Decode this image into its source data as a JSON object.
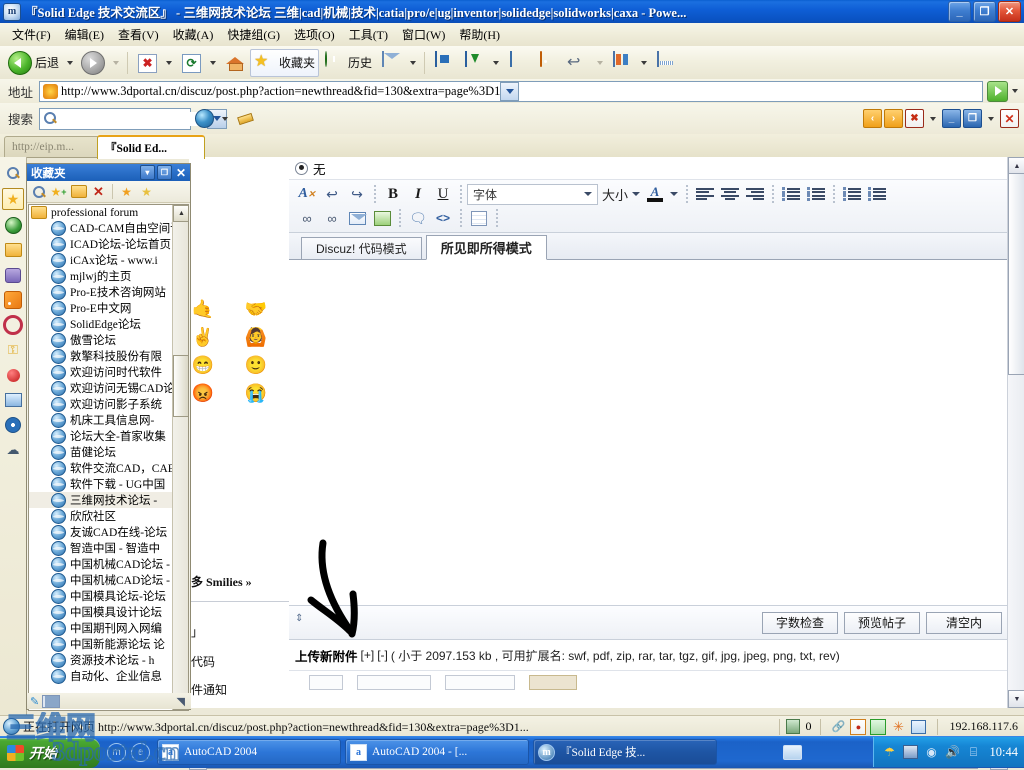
{
  "window": {
    "title": "『Solid Edge 技术交流区』 - 三维网技术论坛 三维|cad|机械|技术|catia|pro/e|ug|inventor|solidedge|solidworks|caxa - Powe...",
    "app_icon": "ie-icon",
    "minimize": "_",
    "restore": "❐",
    "close": "✕"
  },
  "menubar": {
    "items": [
      {
        "label": "文件(F)",
        "name": "menu-file"
      },
      {
        "label": "编辑(E)",
        "name": "menu-edit"
      },
      {
        "label": "查看(V)",
        "name": "menu-view"
      },
      {
        "label": "收藏(A)",
        "name": "menu-favorites"
      },
      {
        "label": "快捷组(G)",
        "name": "menu-group"
      },
      {
        "label": "选项(O)",
        "name": "menu-options"
      },
      {
        "label": "工具(T)",
        "name": "menu-tools"
      },
      {
        "label": "窗口(W)",
        "name": "menu-window"
      },
      {
        "label": "帮助(H)",
        "name": "menu-help"
      }
    ]
  },
  "toolbar": {
    "back_label": "后退",
    "favorites_label": "收藏夹",
    "history_label": "历史",
    "icons": [
      "back-icon",
      "forward-icon",
      "stop-icon",
      "refresh-icon",
      "home-icon",
      "favorites-star-icon",
      "history-icon",
      "mail-icon",
      "media-icon",
      "download-icon",
      "edit-icon",
      "rss-icon",
      "undo-icon",
      "messenger-icon",
      "screen-icon"
    ]
  },
  "address": {
    "label": "地址",
    "url": "http://www.3dportal.cn/discuz/post.php?action=newthread&fid=130&extra=page%3D1",
    "go_icon": "go-arrow-icon"
  },
  "search": {
    "label": "搜索",
    "value": "",
    "placeholder": ""
  },
  "tabs": [
    {
      "label": "http://eip.m...",
      "active": false,
      "name": "tab-eip"
    },
    {
      "label": "『Solid Ed...",
      "active": true,
      "name": "tab-solid-edge"
    }
  ],
  "rail": {
    "icons": [
      "search-icon",
      "favorites-star-icon",
      "globe-icon",
      "folder-icon",
      "drum-icon",
      "rss-icon",
      "record-icon",
      "key-icon",
      "apple-icon",
      "monitor-icon",
      "disc-icon",
      "cloud-icon"
    ]
  },
  "favorites": {
    "title": "收藏夹",
    "header_buttons": [
      "dropdown-icon",
      "restore-icon",
      "close-icon"
    ],
    "tool_icons": [
      "search-icon",
      "add-favorite-icon",
      "new-folder-icon",
      "delete-icon",
      "organize-icon",
      "find-icon"
    ],
    "root_folder": "professional forum",
    "items": [
      "CAD-CAM自由空间论",
      "ICAD论坛-论坛首页",
      "iCAx论坛 - www.i",
      "mjlwj的主页",
      "Pro-E技术咨询网站",
      "Pro-E中文网",
      "SolidEdge论坛",
      "傲雪论坛",
      "敦擎科技股份有限",
      "欢迎访问时代软件",
      "欢迎访问无锡CAD论",
      "欢迎访问影子系统",
      "机床工具信息网-",
      "论坛大全-首家收集",
      "苗健论坛",
      "软件交流CAD，CAE",
      "软件下载 - UG中国",
      "三维网技术论坛 -",
      "欣欣社区",
      "友诚CAD在线-论坛",
      "智造中国 - 智造中",
      "中国机械CAD论坛 -",
      "中国机械CAD论坛 -",
      "中国模具论坛-论坛",
      "中国模具设计论坛",
      "中国期刊网入网编",
      "中国新能源论坛 论",
      "资源技术论坛 - h",
      "自动化、企业信息"
    ],
    "highlighted_item": "三维网技术论坛 -"
  },
  "background_panel": {
    "emoticons": [
      "🤙",
      "🤝",
      "✌",
      "🙆",
      "😁",
      "🙂",
      "😡",
      "😭"
    ],
    "more_smilies": "多 Smilies »",
    "options": [
      "」",
      "代码",
      "件通知"
    ]
  },
  "editor": {
    "radio_label": "无",
    "radio_checked": true,
    "font_combo": {
      "value": "字体",
      "name": "font-family-select"
    },
    "size_label": "大小",
    "toolbar_row1": [
      "clear-format-icon",
      "undo-icon",
      "redo-icon",
      "bold-icon",
      "italic-icon",
      "underline-icon",
      "font-family-select",
      "font-size-select",
      "font-color-icon",
      "align-left-icon",
      "align-center-icon",
      "align-right-icon",
      "ordered-list-icon",
      "unordered-list-icon",
      "outdent-icon",
      "indent-icon"
    ],
    "toolbar_row2": [
      "link-icon",
      "unlink-icon",
      "email-icon",
      "image-icon",
      "quote-icon",
      "code-icon",
      "table-icon"
    ],
    "mode_tabs": [
      {
        "label": "Discuz! 代码模式",
        "active": false,
        "name": "tab-bbcode-mode"
      },
      {
        "label": "所见即所得模式",
        "active": true,
        "name": "tab-wysiwyg-mode"
      }
    ],
    "body_text": "",
    "footer_buttons": [
      {
        "label": "字数检查",
        "name": "word-count-button"
      },
      {
        "label": "预览帖子",
        "name": "preview-post-button"
      },
      {
        "label": "清空内",
        "name": "clear-content-button"
      }
    ],
    "attachment": {
      "link_label": "上传新附件",
      "expand": "[+]",
      "collapse": "[-]",
      "info": "( 小于 2097.153 kb , 可用扩展名: swf, pdf, zip, rar, tar, tgz, gif, jpg, jpeg, png, txt, rev)"
    }
  },
  "statusbar": {
    "loading_text": "正在打开网页",
    "url": "http://www.3dportal.cn/discuz/post.php?action=newthread&fid=130&extra=page%3D1...",
    "counter": "0",
    "zone": "192.168.117.6",
    "icons": [
      "trash-icon",
      "link-icon",
      "block-icon",
      "shield-icon",
      "sun-icon",
      "popup-icon"
    ]
  },
  "taskbar": {
    "start_label": "开始",
    "quick_launch": [
      "maxthon-icon",
      "ie-icon"
    ],
    "tasks": [
      {
        "label": "AutoCAD 2004",
        "icon": "autocad-icon",
        "active": false,
        "name": "task-autocad-1"
      },
      {
        "label": "AutoCAD 2004 - [...",
        "icon": "autocad-icon",
        "active": false,
        "name": "task-autocad-2"
      },
      {
        "label": "『Solid Edge 技...",
        "icon": "ie-icon",
        "active": true,
        "name": "task-solid-edge"
      }
    ],
    "tray_icons": [
      "umbrella-icon",
      "network-icon",
      "shield-icon",
      "volume-icon",
      "ime-icon"
    ],
    "clock": "10:44"
  },
  "watermark": {
    "line1": "三维网",
    "line2": "3dportal.cn"
  },
  "colors": {
    "titlebar": "#0f5fd6",
    "toolbar_bg": "#f2f0e0",
    "accent_orange": "#e8a317",
    "taskbar_blue": "#1b62c8",
    "start_green": "#3a9026"
  }
}
